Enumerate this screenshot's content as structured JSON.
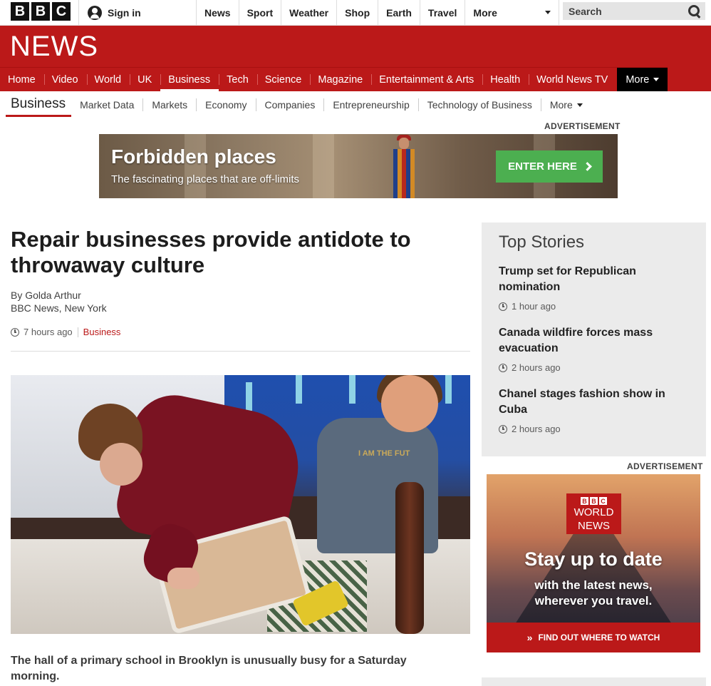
{
  "topbar": {
    "logo_letters": [
      "B",
      "B",
      "C"
    ],
    "signin_label": "Sign in",
    "nav": [
      "News",
      "Sport",
      "Weather",
      "Shop",
      "Earth",
      "Travel"
    ],
    "more_label": "More",
    "search_label": "Search"
  },
  "masthead": {
    "wordmark": "NEWS",
    "nav": [
      "Home",
      "Video",
      "World",
      "UK",
      "Business",
      "Tech",
      "Science",
      "Magazine",
      "Entertainment & Arts",
      "Health",
      "World News TV"
    ],
    "active_item": "Business",
    "more_label": "More"
  },
  "subnav": {
    "section": "Business",
    "items": [
      "Market Data",
      "Markets",
      "Economy",
      "Companies",
      "Entrepreneurship",
      "Technology of Business"
    ],
    "more_label": "More"
  },
  "top_ad": {
    "label": "ADVERTISEMENT",
    "title": "Forbidden places",
    "subtitle": "The fascinating places that are off-limits",
    "cta": "ENTER HERE"
  },
  "article": {
    "headline": "Repair businesses provide antidote to throwaway culture",
    "author": "By Golda Arthur",
    "author_role": "BBC News, New York",
    "time": "7 hours ago",
    "topic": "Business",
    "photo_shirt_text": "I AM THE FUT",
    "lede": "The hall of a primary school in Brooklyn is unusually busy for a Saturday morning."
  },
  "top_stories": {
    "title": "Top Stories",
    "items": [
      {
        "headline": "Trump set for Republican nomination",
        "time": "1 hour ago"
      },
      {
        "headline": "Canada wildfire forces mass evacuation",
        "time": "2 hours ago"
      },
      {
        "headline": "Chanel stages fashion show in Cuba",
        "time": "2 hours ago"
      }
    ]
  },
  "side_ad": {
    "label": "ADVERTISEMENT",
    "logo_letters": [
      "B",
      "B",
      "C"
    ],
    "logo_line1": "WORLD",
    "logo_line2": "NEWS",
    "title": "Stay up to date",
    "sub1": "with the latest news,",
    "sub2": "wherever you travel.",
    "cta": "FIND OUT WHERE TO WATCH"
  },
  "colors": {
    "brand_red": "#bb1919",
    "cta_green": "#4caf50",
    "sidebar_grey": "#ebebeb"
  }
}
